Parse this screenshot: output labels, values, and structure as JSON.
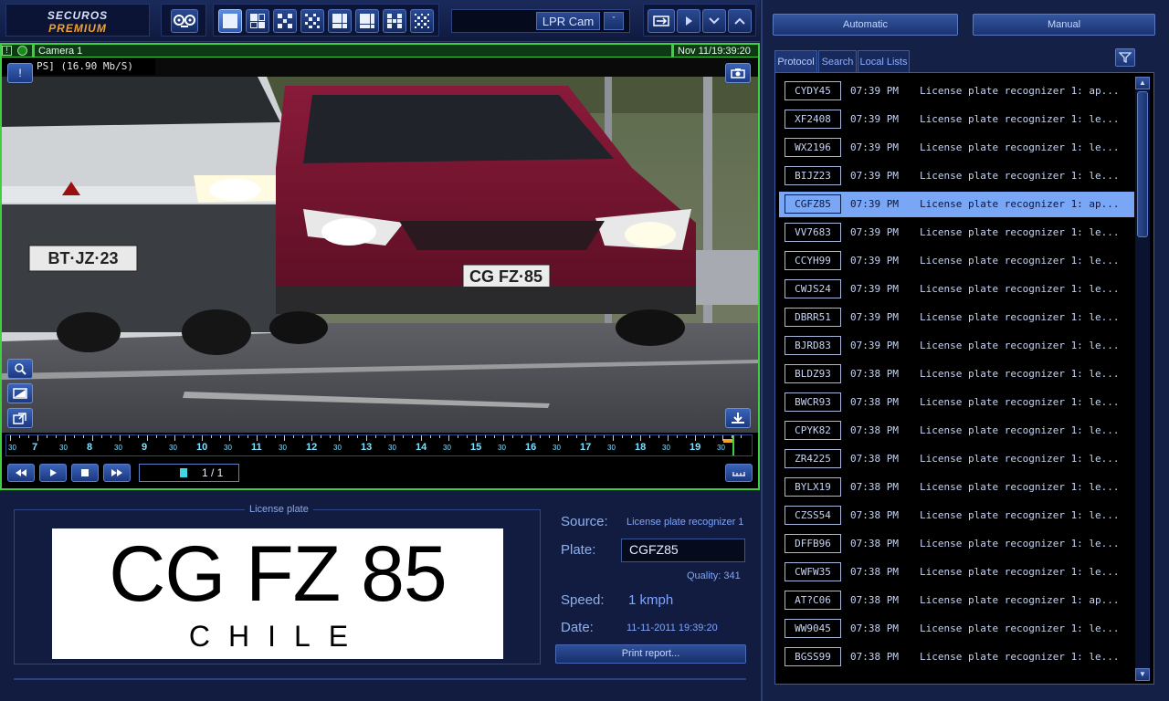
{
  "logo": {
    "line1": "SECUROS",
    "line2": "PREMIUM"
  },
  "toolbar": {
    "camera_name": "LPR Cam",
    "camera_dropdown": "ˇ",
    "layout_buttons": [
      "1x1",
      "1+3",
      "2x2 small",
      "3x3",
      "1+5",
      "1+7",
      "2x3",
      "4x4"
    ]
  },
  "video": {
    "status_icon": "info-icon",
    "camera_label": "Camera 1",
    "timestamp": "Nov 11/19:39:20",
    "stream_info": "PS] (16.90 Mb/S)",
    "scene_plate_left": "BT·JZ·23",
    "scene_plate_right": "CG FZ·85",
    "timeline_hours": [
      "7",
      "8",
      "9",
      "10",
      "11",
      "12",
      "13",
      "14",
      "15",
      "16",
      "17",
      "18",
      "19"
    ],
    "timeline_half": "30",
    "page_indicator": "1 / 1"
  },
  "license_plate": {
    "section_label": "License plate",
    "plate_text": "CG FZ 85",
    "country": "CHILE",
    "source_label": "Source:",
    "source_value": "License plate recognizer 1",
    "plate_label": "Plate:",
    "plate_value": "CGFZ85",
    "quality_text": "Quality: 341",
    "speed_label": "Speed:",
    "speed_value": "1 kmph",
    "date_label": "Date:",
    "date_value": "11-11-2011 19:39:20",
    "print_button": "Print report..."
  },
  "right_panel": {
    "automatic_button": "Automatic",
    "manual_button": "Manual",
    "tabs": [
      "Protocol",
      "Search",
      "Local Lists"
    ],
    "rows": [
      {
        "plate": "CYDY45",
        "time": "07:39 PM",
        "event": "License plate recognizer 1: ap..."
      },
      {
        "plate": "XF2408",
        "time": "07:39 PM",
        "event": "License plate recognizer 1: le..."
      },
      {
        "plate": "WX2196",
        "time": "07:39 PM",
        "event": "License plate recognizer 1: le..."
      },
      {
        "plate": "BIJZ23",
        "time": "07:39 PM",
        "event": "License plate recognizer 1: le..."
      },
      {
        "plate": "CGFZ85",
        "time": "07:39 PM",
        "event": "License plate recognizer 1: ap..."
      },
      {
        "plate": "VV7683",
        "time": "07:39 PM",
        "event": "License plate recognizer 1: le..."
      },
      {
        "plate": "CCYH99",
        "time": "07:39 PM",
        "event": "License plate recognizer 1: le..."
      },
      {
        "plate": "CWJS24",
        "time": "07:39 PM",
        "event": "License plate recognizer 1: le..."
      },
      {
        "plate": "DBRR51",
        "time": "07:39 PM",
        "event": "License plate recognizer 1: le..."
      },
      {
        "plate": "BJRD83",
        "time": "07:39 PM",
        "event": "License plate recognizer 1: le..."
      },
      {
        "plate": "BLDZ93",
        "time": "07:38 PM",
        "event": "License plate recognizer 1: le..."
      },
      {
        "plate": "BWCR93",
        "time": "07:38 PM",
        "event": "License plate recognizer 1: le..."
      },
      {
        "plate": "CPYK82",
        "time": "07:38 PM",
        "event": "License plate recognizer 1: le..."
      },
      {
        "plate": "ZR4225",
        "time": "07:38 PM",
        "event": "License plate recognizer 1: le..."
      },
      {
        "plate": "BYLX19",
        "time": "07:38 PM",
        "event": "License plate recognizer 1: le..."
      },
      {
        "plate": "CZSS54",
        "time": "07:38 PM",
        "event": "License plate recognizer 1: le..."
      },
      {
        "plate": "DFFB96",
        "time": "07:38 PM",
        "event": "License plate recognizer 1: le..."
      },
      {
        "plate": "CWFW35",
        "time": "07:38 PM",
        "event": "License plate recognizer 1: le..."
      },
      {
        "plate": "AT?C06",
        "time": "07:38 PM",
        "event": "License plate recognizer 1: ap..."
      },
      {
        "plate": "WW9045",
        "time": "07:38 PM",
        "event": "License plate recognizer 1: le..."
      },
      {
        "plate": "BGSS99",
        "time": "07:38 PM",
        "event": "License plate recognizer 1: le..."
      }
    ],
    "selected_index": 4
  },
  "colors": {
    "selection": "#7aa6f6",
    "frame_green": "#3fcf3f",
    "accent_orange": "#f2a12a",
    "timeline_text": "#7fe0ff"
  }
}
